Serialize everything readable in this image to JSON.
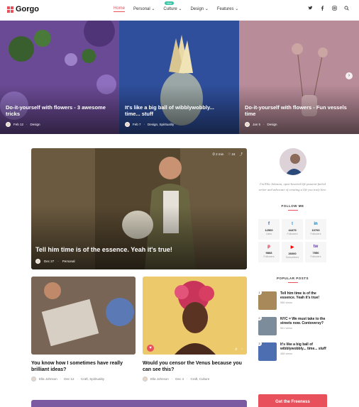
{
  "brand": {
    "name": "Gorgo",
    "accent": "#e8505b"
  },
  "nav": {
    "items": [
      {
        "label": "Home",
        "active": true
      },
      {
        "label": "Personal",
        "caret": "⌄"
      },
      {
        "label": "Culture",
        "caret": "⌄",
        "badge": "Hot"
      },
      {
        "label": "Design",
        "caret": "⌄"
      },
      {
        "label": "Features",
        "caret": "⌄"
      }
    ]
  },
  "header_icons": [
    "twitter-icon",
    "facebook-icon",
    "instagram-icon",
    "search-icon"
  ],
  "hero": [
    {
      "title": "Do-it-yourself with flowers - 3 awesome tricks",
      "date": "Feb 12",
      "category": "Design"
    },
    {
      "title": "It's like a big ball of wibblywobbly... time... stuff",
      "date": "Feb 7",
      "category": "Design, Spirituality"
    },
    {
      "title": "Do-it-yourself with flowers - Fun vessels time",
      "date": "Jan 5",
      "category": "Design"
    }
  ],
  "feature": {
    "title": "Tell him time is of the essence. Yeah it's true!",
    "date": "Dec 27",
    "category": "Personal",
    "views": "2 min",
    "likes": "24"
  },
  "cards": [
    {
      "title": "You know how I sometimes have really brilliant ideas?",
      "author": "Ella Johnson",
      "date": "Dec 12",
      "category": "Craft, Spirituality"
    },
    {
      "title": "Would you censor the Venus because you can see this?",
      "author": "Ella Johnson",
      "date": "Dec 4",
      "category": "Craft, Culture"
    }
  ],
  "sidebar": {
    "bio": "I'm Ella Johnson, open-hearted life passion-fueled writer and advocate of creating a life you truly love.",
    "follow_label": "FOLLOW ME",
    "social": [
      {
        "icon": "f",
        "count": "12500",
        "label": "Likes",
        "color": "#3b5998"
      },
      {
        "icon": "t",
        "count": "44479",
        "label": "Followers",
        "color": "#1da1f2"
      },
      {
        "icon": "in",
        "count": "10700",
        "label": "Followers",
        "color": "#0077b5"
      },
      {
        "icon": "p",
        "count": "9868",
        "label": "Followers",
        "color": "#e60023"
      },
      {
        "icon": "▶",
        "count": "26000",
        "label": "Subscribers",
        "color": "#ff0000"
      },
      {
        "icon": "tw",
        "count": "7550",
        "label": "Followers",
        "color": "#6441a5"
      }
    ],
    "popular_label": "POPULAR POSTS",
    "popular": [
      {
        "num": "1",
        "title": "Tell him time is of the essence. Yeah it's true!",
        "views": "986 views"
      },
      {
        "num": "2",
        "title": "NYC = We must take to the streets now. Contoversy?",
        "views": "561 views"
      },
      {
        "num": "3",
        "title": "It's like a big ball of wibblywobbly... time... stuff",
        "views": "488 views"
      }
    ],
    "cta": "Get the Freeness"
  }
}
